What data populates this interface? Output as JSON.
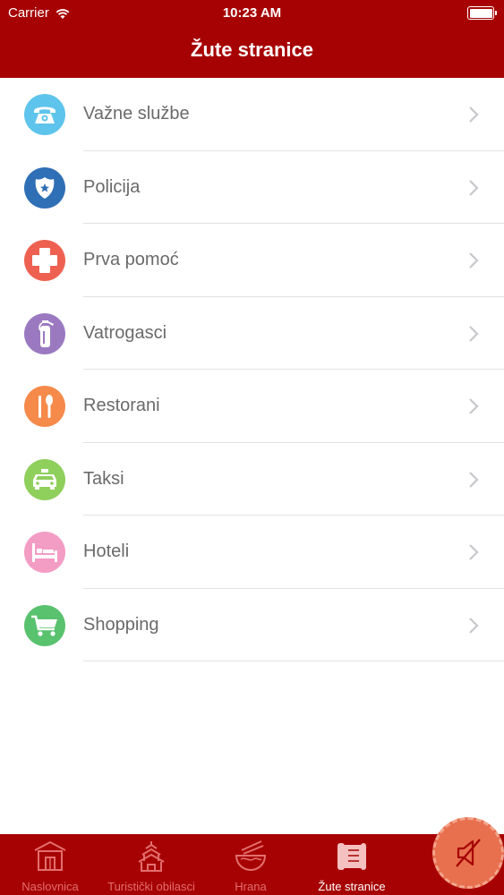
{
  "status_bar": {
    "carrier": "Carrier",
    "time": "10:23 AM"
  },
  "header": {
    "title": "Žute stranice"
  },
  "list": {
    "items": [
      {
        "label": "Važne službe",
        "icon": "telephone-icon",
        "color": "#5ec4ec"
      },
      {
        "label": "Policija",
        "icon": "police-badge-icon",
        "color": "#2f6fb5"
      },
      {
        "label": "Prva pomoć",
        "icon": "first-aid-cross-icon",
        "color": "#ee6151"
      },
      {
        "label": "Vatrogasci",
        "icon": "fire-extinguisher-icon",
        "color": "#9b79c1"
      },
      {
        "label": "Restorani",
        "icon": "cutlery-icon",
        "color": "#f58a4b"
      },
      {
        "label": "Taksi",
        "icon": "taxi-icon",
        "color": "#8fcf5c"
      },
      {
        "label": "Hoteli",
        "icon": "bed-icon",
        "color": "#f39cc4"
      },
      {
        "label": "Shopping",
        "icon": "shopping-cart-icon",
        "color": "#59c26e"
      }
    ]
  },
  "tabbar": {
    "tabs": [
      {
        "label": "Naslovnica",
        "icon": "house-icon",
        "active": false
      },
      {
        "label": "Turistički obilasci",
        "icon": "pagoda-icon",
        "active": false
      },
      {
        "label": "Hrana",
        "icon": "noodle-bowl-icon",
        "active": false
      },
      {
        "label": "Žute stranice",
        "icon": "scroll-icon",
        "active": true
      }
    ],
    "fab_icon": "mute-speaker-icon"
  },
  "colors": {
    "brand": "#a70203",
    "fab": "#e8704f",
    "text": "#6a6a6a"
  }
}
